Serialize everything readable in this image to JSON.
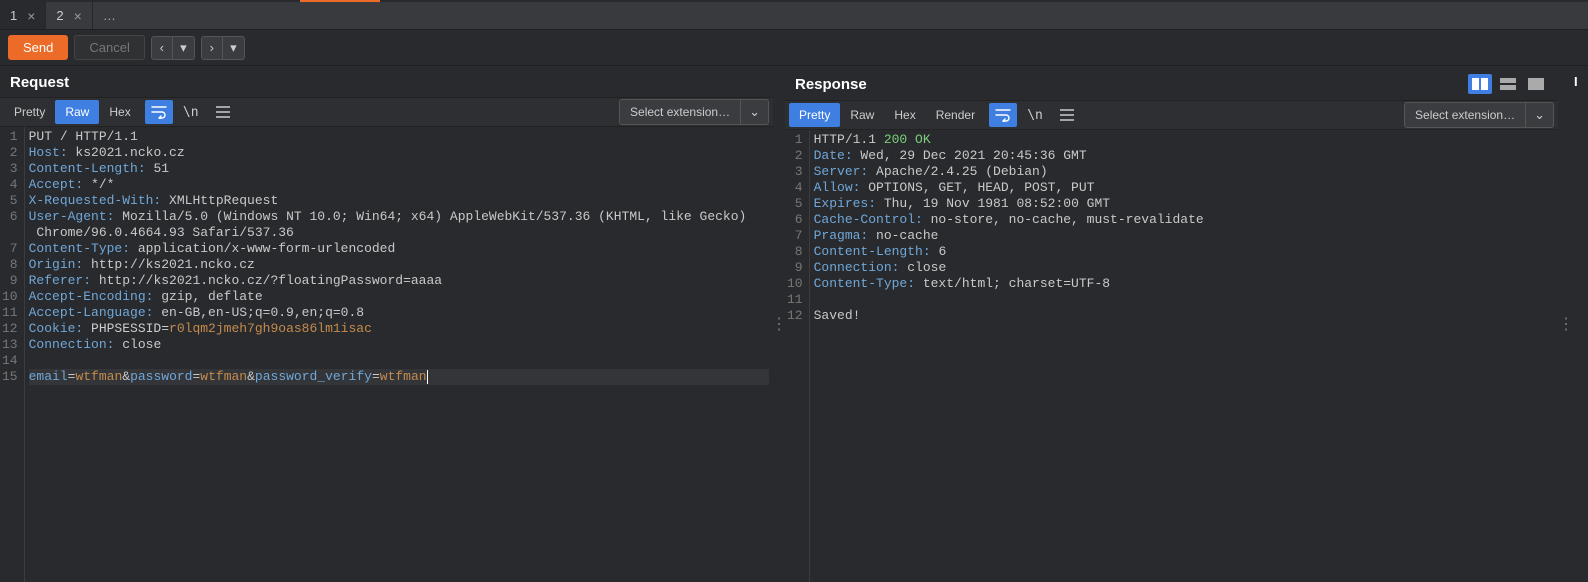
{
  "tabs": [
    {
      "label": "1"
    },
    {
      "label": "2"
    },
    {
      "label": "…"
    }
  ],
  "actions": {
    "send": "Send",
    "cancel": "Cancel"
  },
  "request": {
    "title": "Request",
    "fmt": {
      "pretty": "Pretty",
      "raw": "Raw",
      "hex": "Hex"
    },
    "ext_label": "Select extension…",
    "lines": [
      [
        {
          "c": "method",
          "t": "PUT / HTTP/1.1"
        }
      ],
      [
        {
          "c": "hk",
          "t": "Host:"
        },
        {
          "c": "hv",
          "t": " ks2021.ncko.cz"
        }
      ],
      [
        {
          "c": "hk",
          "t": "Content-Length:"
        },
        {
          "c": "hv",
          "t": " 51"
        }
      ],
      [
        {
          "c": "hk",
          "t": "Accept:"
        },
        {
          "c": "hv",
          "t": " */*"
        }
      ],
      [
        {
          "c": "hk",
          "t": "X-Requested-With:"
        },
        {
          "c": "hv",
          "t": " XMLHttpRequest"
        }
      ],
      [
        {
          "c": "hk",
          "t": "User-Agent:"
        },
        {
          "c": "hv",
          "t": " Mozilla/5.0 (Windows NT 10.0; Win64; x64) AppleWebKit/537.36 (KHTML, like Gecko)"
        }
      ],
      [
        {
          "c": "hv",
          "t": " Chrome/96.0.4664.93 Safari/537.36"
        }
      ],
      [
        {
          "c": "hk",
          "t": "Content-Type:"
        },
        {
          "c": "hv",
          "t": " application/x-www-form-urlencoded"
        }
      ],
      [
        {
          "c": "hk",
          "t": "Origin:"
        },
        {
          "c": "hv",
          "t": " http://ks2021.ncko.cz"
        }
      ],
      [
        {
          "c": "hk",
          "t": "Referer:"
        },
        {
          "c": "hv",
          "t": " http://ks2021.ncko.cz/?floatingPassword=aaaa"
        }
      ],
      [
        {
          "c": "hk",
          "t": "Accept-Encoding:"
        },
        {
          "c": "hv",
          "t": " gzip, deflate"
        }
      ],
      [
        {
          "c": "hk",
          "t": "Accept-Language:"
        },
        {
          "c": "hv",
          "t": " en-GB,en-US;q=0.9,en;q=0.8"
        }
      ],
      [
        {
          "c": "hk",
          "t": "Cookie:"
        },
        {
          "c": "cookie",
          "t": " PHPSESSID="
        },
        {
          "c": "cookie-val",
          "t": "r0lqm2jmeh7gh9oas86lm1isac"
        }
      ],
      [
        {
          "c": "hk",
          "t": "Connection:"
        },
        {
          "c": "hv",
          "t": " close"
        }
      ],
      [
        {
          "c": "hv",
          "t": ""
        }
      ],
      [
        {
          "c": "param",
          "t": "email"
        },
        {
          "c": "hv",
          "t": "="
        },
        {
          "c": "val-orange",
          "t": "wtfman"
        },
        {
          "c": "hv",
          "t": "&"
        },
        {
          "c": "param",
          "t": "password"
        },
        {
          "c": "hv",
          "t": "="
        },
        {
          "c": "val-orange",
          "t": "wtfman"
        },
        {
          "c": "hv",
          "t": "&"
        },
        {
          "c": "param",
          "t": "password_verify"
        },
        {
          "c": "hv",
          "t": "="
        },
        {
          "c": "val-orange",
          "t": "wtfman"
        }
      ]
    ],
    "gutter": [
      "1",
      "2",
      "3",
      "4",
      "5",
      "6",
      " ",
      "7",
      "8",
      "9",
      "10",
      "11",
      "12",
      "13",
      "14",
      "15"
    ],
    "highlight_index": 15
  },
  "response": {
    "title": "Response",
    "fmt": {
      "pretty": "Pretty",
      "raw": "Raw",
      "hex": "Hex",
      "render": "Render"
    },
    "ext_label": "Select extension…",
    "lines": [
      [
        {
          "c": "hv",
          "t": "HTTP/1.1 "
        },
        {
          "c": "status-ok",
          "t": "200 OK"
        }
      ],
      [
        {
          "c": "hk",
          "t": "Date:"
        },
        {
          "c": "hv",
          "t": " Wed, 29 Dec 2021 20:45:36 GMT"
        }
      ],
      [
        {
          "c": "hk",
          "t": "Server:"
        },
        {
          "c": "hv",
          "t": " Apache/2.4.25 (Debian)"
        }
      ],
      [
        {
          "c": "hk",
          "t": "Allow:"
        },
        {
          "c": "hv",
          "t": " OPTIONS, GET, HEAD, POST, PUT"
        }
      ],
      [
        {
          "c": "hk",
          "t": "Expires:"
        },
        {
          "c": "hv",
          "t": " Thu, 19 Nov 1981 08:52:00 GMT"
        }
      ],
      [
        {
          "c": "hk",
          "t": "Cache-Control:"
        },
        {
          "c": "hv",
          "t": " no-store, no-cache, must-revalidate"
        }
      ],
      [
        {
          "c": "hk",
          "t": "Pragma:"
        },
        {
          "c": "hv",
          "t": " no-cache"
        }
      ],
      [
        {
          "c": "hk",
          "t": "Content-Length:"
        },
        {
          "c": "hv",
          "t": " 6"
        }
      ],
      [
        {
          "c": "hk",
          "t": "Connection:"
        },
        {
          "c": "hv",
          "t": " close"
        }
      ],
      [
        {
          "c": "hk",
          "t": "Content-Type:"
        },
        {
          "c": "hv",
          "t": " text/html; charset=UTF-8"
        }
      ],
      [
        {
          "c": "hv",
          "t": ""
        }
      ],
      [
        {
          "c": "hv",
          "t": "Saved!"
        }
      ]
    ],
    "gutter": [
      "1",
      "2",
      "3",
      "4",
      "5",
      "6",
      "7",
      "8",
      "9",
      "10",
      "11",
      "12"
    ]
  }
}
